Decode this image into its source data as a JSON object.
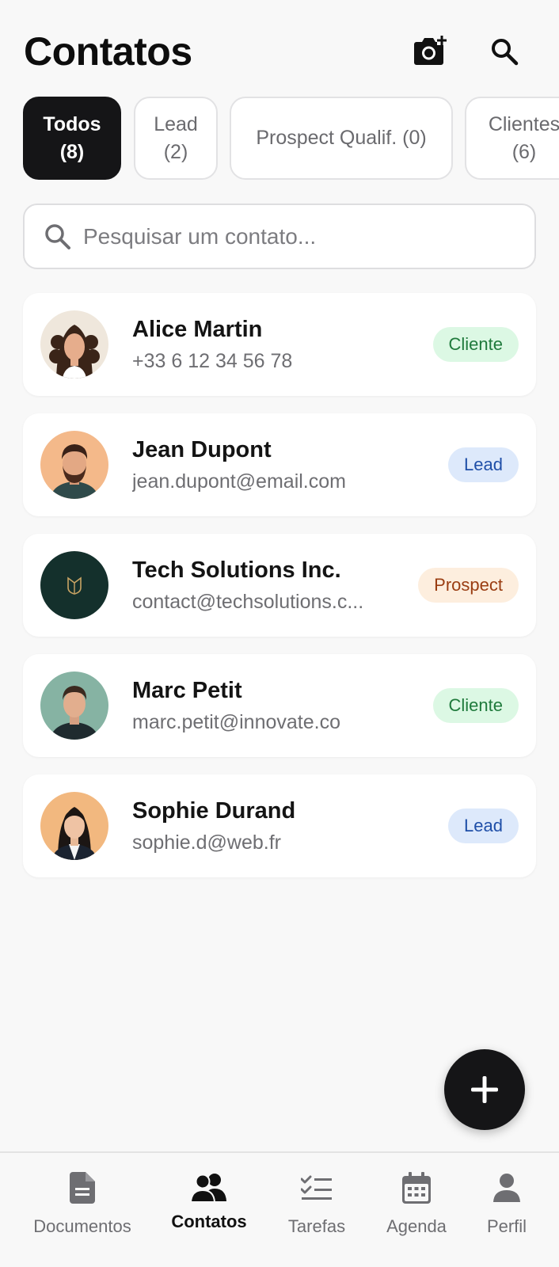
{
  "header": {
    "title": "Contatos",
    "camera_icon": "camera-plus-icon",
    "search_icon": "search-icon"
  },
  "filters": [
    {
      "label": "Todos\n(8)",
      "active": true
    },
    {
      "label": "Lead\n(2)",
      "active": false
    },
    {
      "label": "Prospect Qualif. (0)",
      "active": false
    },
    {
      "label": "Clientes\n(6)",
      "active": false
    }
  ],
  "search": {
    "placeholder": "Pesquisar um contato...",
    "value": ""
  },
  "contacts": [
    {
      "name": "Alice Martin",
      "subtitle": "+33 6 12 34 56 78",
      "badge": "Cliente",
      "badge_type": "cliente"
    },
    {
      "name": "Jean Dupont",
      "subtitle": "jean.dupont@email.com",
      "badge": "Lead",
      "badge_type": "lead"
    },
    {
      "name": "Tech Solutions Inc.",
      "subtitle": "contact@techsolutions.c...",
      "badge": "Prospect",
      "badge_type": "prospect"
    },
    {
      "name": "Marc Petit",
      "subtitle": "marc.petit@innovate.co",
      "badge": "Cliente",
      "badge_type": "cliente"
    },
    {
      "name": "Sophie Durand",
      "subtitle": "sophie.d@web.fr",
      "badge": "Lead",
      "badge_type": "lead"
    }
  ],
  "fab": {
    "icon": "plus-icon"
  },
  "nav": [
    {
      "label": "Documentos",
      "icon": "document-icon",
      "active": false
    },
    {
      "label": "Contatos",
      "icon": "contacts-icon",
      "active": true
    },
    {
      "label": "Tarefas",
      "icon": "tasks-icon",
      "active": false
    },
    {
      "label": "Agenda",
      "icon": "calendar-icon",
      "active": false
    },
    {
      "label": "Perfil",
      "icon": "profile-icon",
      "active": false
    }
  ],
  "colors": {
    "background": "#f8f8f8",
    "primary": "#151517",
    "badge_cliente_bg": "#dcf8e4",
    "badge_cliente_text": "#1f7a3c",
    "badge_lead_bg": "#dde9fb",
    "badge_lead_text": "#1f4fa8",
    "badge_prospect_bg": "#fdeede",
    "badge_prospect_text": "#9a3d12"
  }
}
